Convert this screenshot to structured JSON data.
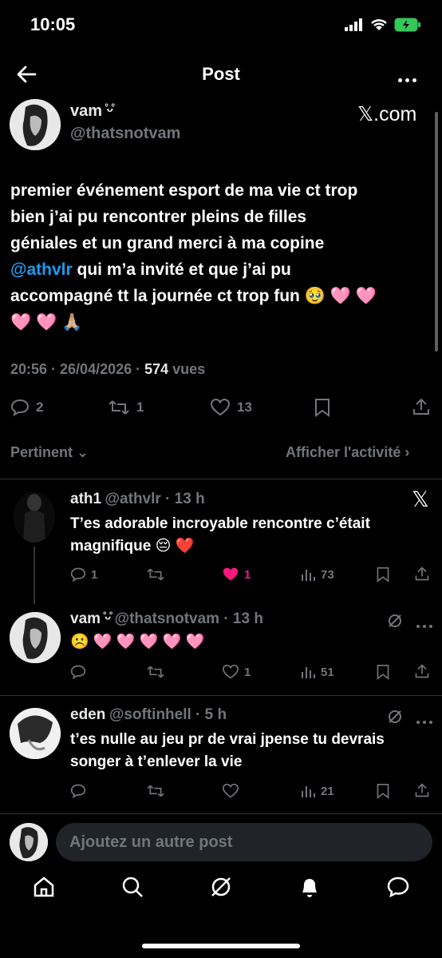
{
  "status_bar": {
    "time": "10:05"
  },
  "header": {
    "title": "Post"
  },
  "post": {
    "author_name": "vam ̊ᵕ̊",
    "author_handle": "@thatsnotvam",
    "source_badge": "𝕏.com",
    "text_line1": "premier événement esport de ma vie ct trop",
    "text_line2": "bien j’ai pu rencontrer pleins de filles",
    "text_line3": "géniales et un grand merci à ma copine",
    "mention": "@athvlr",
    "text_line4_rest": " qui m’a invité et que j’ai pu",
    "text_line5": "accompagné tt la journée ct trop fun 🥹 🩷 🩷",
    "text_line6": "🩷 🩷 🙏🏼",
    "time": "20:56 · 26/04/2026 · ",
    "views_count": "574",
    "views_label": " vues",
    "replies": "2",
    "reposts": "1",
    "likes": "13"
  },
  "sort": {
    "label": "Pertinent",
    "activity": "Afficher l'activité"
  },
  "replies": [
    {
      "name": "ath1",
      "handle": "@athvlr · 13 h",
      "text_line1": "T’es adorable incroyable rencontre c’était",
      "text_line2": "magnifique 😔 ❤️",
      "replies": "1",
      "reposts": "",
      "likes": "1",
      "views": "73"
    },
    {
      "name": "vam ̊ᵕ̊",
      "handle": "@thatsnotvam · 13 h",
      "text_line1": "☹️ 🩷 🩷 🩷 🩷 🩷",
      "replies": "",
      "reposts": "",
      "likes": "1",
      "views": "51"
    },
    {
      "name": "eden",
      "handle": "@softinhell · 5 h",
      "text_line1": "t’es nulle au jeu pr de vrai jpense tu devrais",
      "text_line2": "songer à t’enlever la vie",
      "replies": "",
      "reposts": "",
      "likes": "",
      "views": "21"
    }
  ],
  "compose": {
    "placeholder": "Ajoutez un autre post"
  },
  "colors": {
    "accent": "#1d9bf0",
    "like": "#f91880",
    "background": "#000000"
  }
}
